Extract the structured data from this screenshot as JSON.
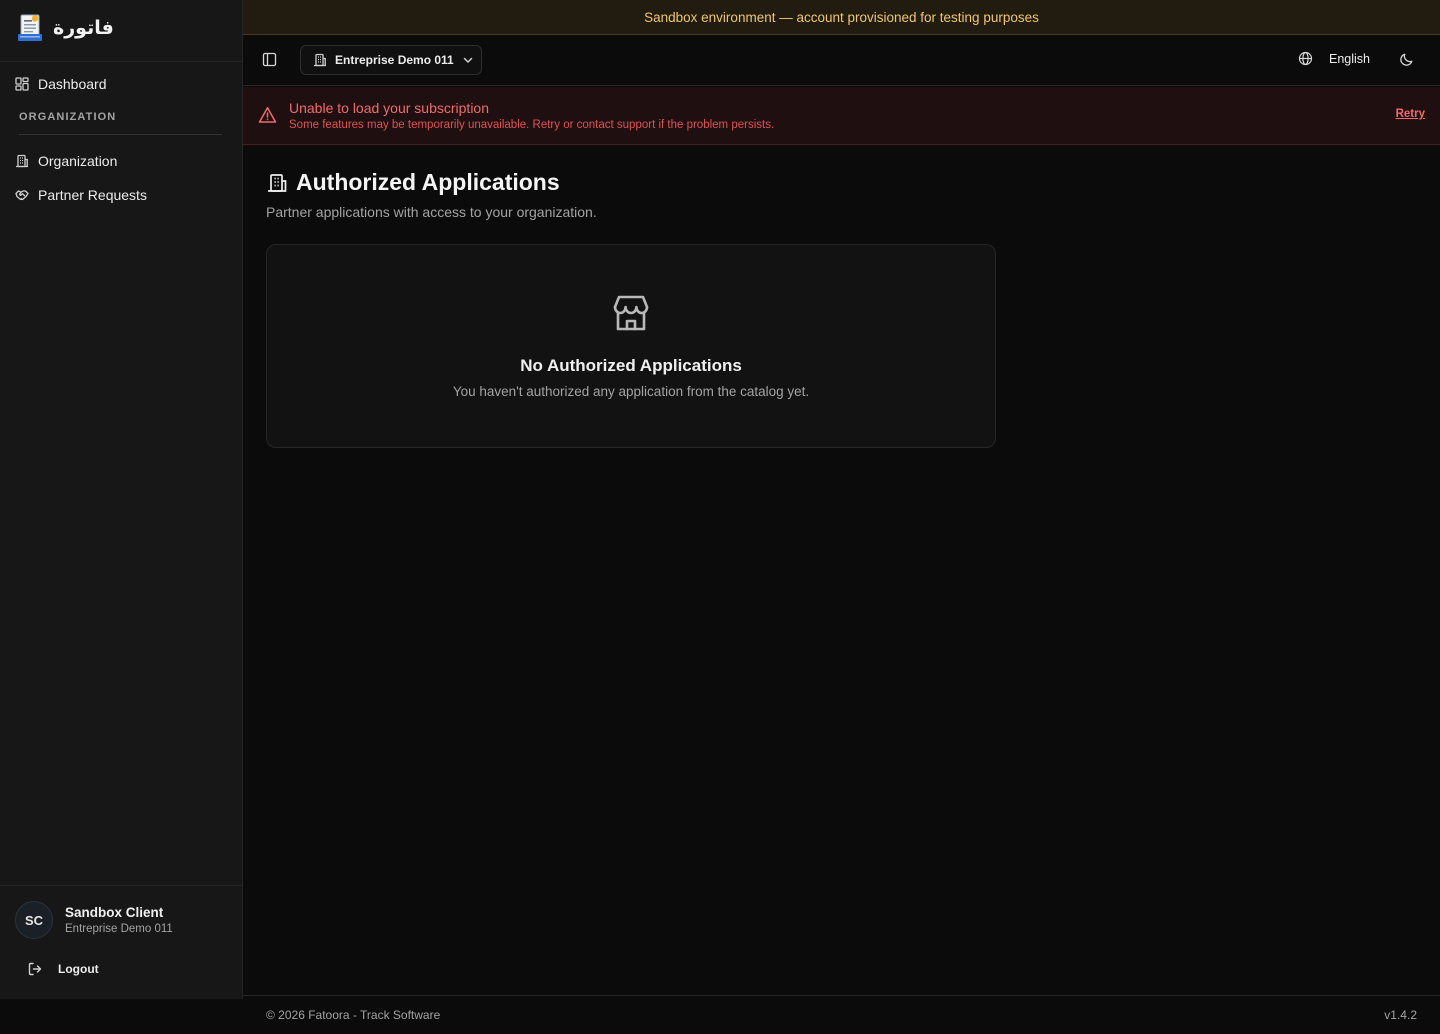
{
  "brand": {
    "logo_text": "فاتورة"
  },
  "sidebar": {
    "dashboard_label": "Dashboard",
    "section_label": "ORGANIZATION",
    "items": [
      {
        "label": "Organization",
        "icon": "building-icon"
      },
      {
        "label": "Partner Requests",
        "icon": "handshake-icon"
      }
    ],
    "user": {
      "initials": "SC",
      "name": "Sandbox Client",
      "org": "Entreprise Demo 011"
    },
    "logout_label": "Logout"
  },
  "banner": {
    "text": "Sandbox environment — account provisioned for testing purposes"
  },
  "header": {
    "org_switcher_label": "Entreprise Demo 011",
    "language_label": "English"
  },
  "alert": {
    "title": "Unable to load your subscription",
    "description": "Some features may be temporarily unavailable. Retry or contact support if the problem persists.",
    "retry_label": "Retry"
  },
  "main": {
    "title": "Authorized Applications",
    "subtitle": "Partner applications with access to your organization.",
    "empty_state": {
      "title": "No Authorized Applications",
      "description": "You haven't authorized any application from the catalog yet."
    }
  },
  "footer": {
    "copyright": "© 2026 Fatoora - Track Software",
    "version": "v1.4.2"
  },
  "colors": {
    "background": "#0b0b0b",
    "sidebar": "#171717",
    "banner_text": "#f0c66a",
    "alert_text": "#f26b6b"
  }
}
